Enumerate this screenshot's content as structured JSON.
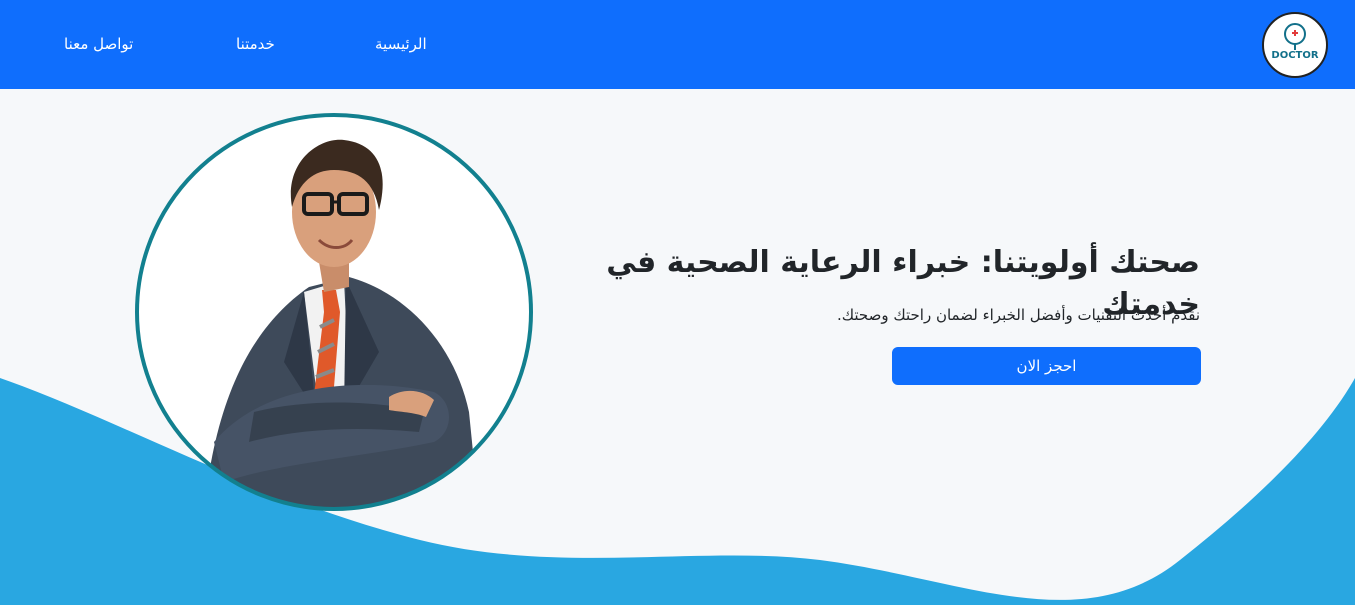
{
  "navbar": {
    "links": {
      "home": "الرئيسية",
      "services": "خدمتنا",
      "contact": "تواصل معنا"
    },
    "logo_text": "DOCTOR"
  },
  "hero": {
    "title": "صحتك أولويتنا: خبراء الرعاية الصحية في خدمتك",
    "subtitle": "نقدم أحدث التقنيات وأفضل الخبراء لضمان راحتك وصحتك.",
    "button_label": "احجز الان"
  },
  "colors": {
    "navbar": "#0f6efd",
    "button": "#0f6efd",
    "wave": "#29a7e1",
    "portrait_border": "#12808f",
    "background": "#f6f8fa"
  }
}
